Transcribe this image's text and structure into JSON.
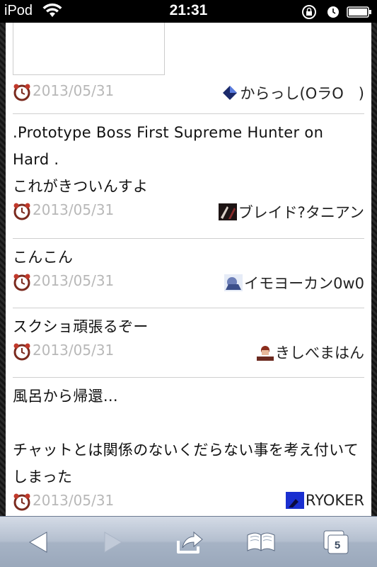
{
  "status_bar": {
    "carrier": "iPod",
    "time": "21:31"
  },
  "posts": [
    {
      "text": "",
      "date": "2013/05/31",
      "user": "からっし(OラO　)",
      "avatar_icon": "diamond-icon"
    },
    {
      "text": ".Prototype Boss First Supreme Hunter on Hard .\nこれがきついんすよ",
      "date": "2013/05/31",
      "user": "ブレイド?タニアン",
      "avatar_icon": "avatar-icon"
    },
    {
      "text": "こんこん",
      "date": "2013/05/31",
      "user": "イモヨーカン0w0",
      "avatar_icon": "avatar-icon"
    },
    {
      "text": "スクショ頑張るぞー",
      "date": "2013/05/31",
      "user": "きしべまはん",
      "avatar_icon": "avatar-icon"
    },
    {
      "text": "風呂から帰還…\n\nチャットとは関係のないくだらない事を考え付いてしまった",
      "date": "2013/05/31",
      "user": "RYOKER",
      "avatar_icon": "avatar-icon"
    }
  ],
  "toolbar": {
    "tabs_count": "5",
    "buttons": [
      "back-icon",
      "forward-icon",
      "share-icon",
      "bookmarks-icon",
      "tabs-icon"
    ]
  },
  "colors": {
    "date_text": "#b8b8b8",
    "toolbar_top": "#d4dbe6",
    "toolbar_bottom": "#9aa8bb"
  }
}
